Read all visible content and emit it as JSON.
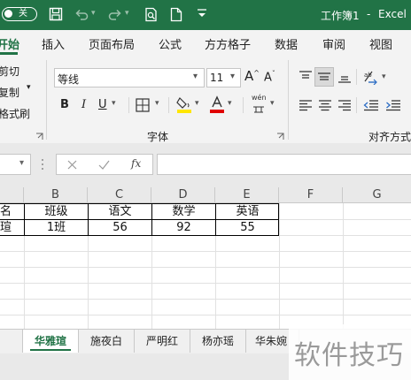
{
  "titlebar": {
    "autosave_label": "关",
    "title": "工作簿1",
    "app": "Excel",
    "sep": "-"
  },
  "tabs": [
    "开始",
    "插入",
    "页面布局",
    "公式",
    "方方格子",
    "数据",
    "审阅",
    "视图"
  ],
  "clipboard": {
    "cut": "剪切",
    "copy": "复制",
    "format_painter": "格式刷"
  },
  "font": {
    "name": "等线",
    "size": "11",
    "group_label": "字体",
    "bold": "B",
    "italic": "I",
    "underline": "U",
    "phonetic": "wén"
  },
  "alignment": {
    "group_label": "对齐方式"
  },
  "formula_bar": {
    "fx": "fx",
    "content": ""
  },
  "columns": [
    "B",
    "C",
    "D",
    "E",
    "F",
    "G"
  ],
  "table": {
    "header": [
      "名",
      "班级",
      "语文",
      "数学",
      "英语"
    ],
    "row": [
      "瑄",
      "1班",
      "56",
      "92",
      "55"
    ]
  },
  "sheets": [
    "华雅瑄",
    "施夜白",
    "严明红",
    "杨亦瑶",
    "华朱婉"
  ],
  "watermark": "软件技巧",
  "colors": {
    "accent": "#217346",
    "font_color": "#e00000",
    "highlight": "#ffe600"
  }
}
